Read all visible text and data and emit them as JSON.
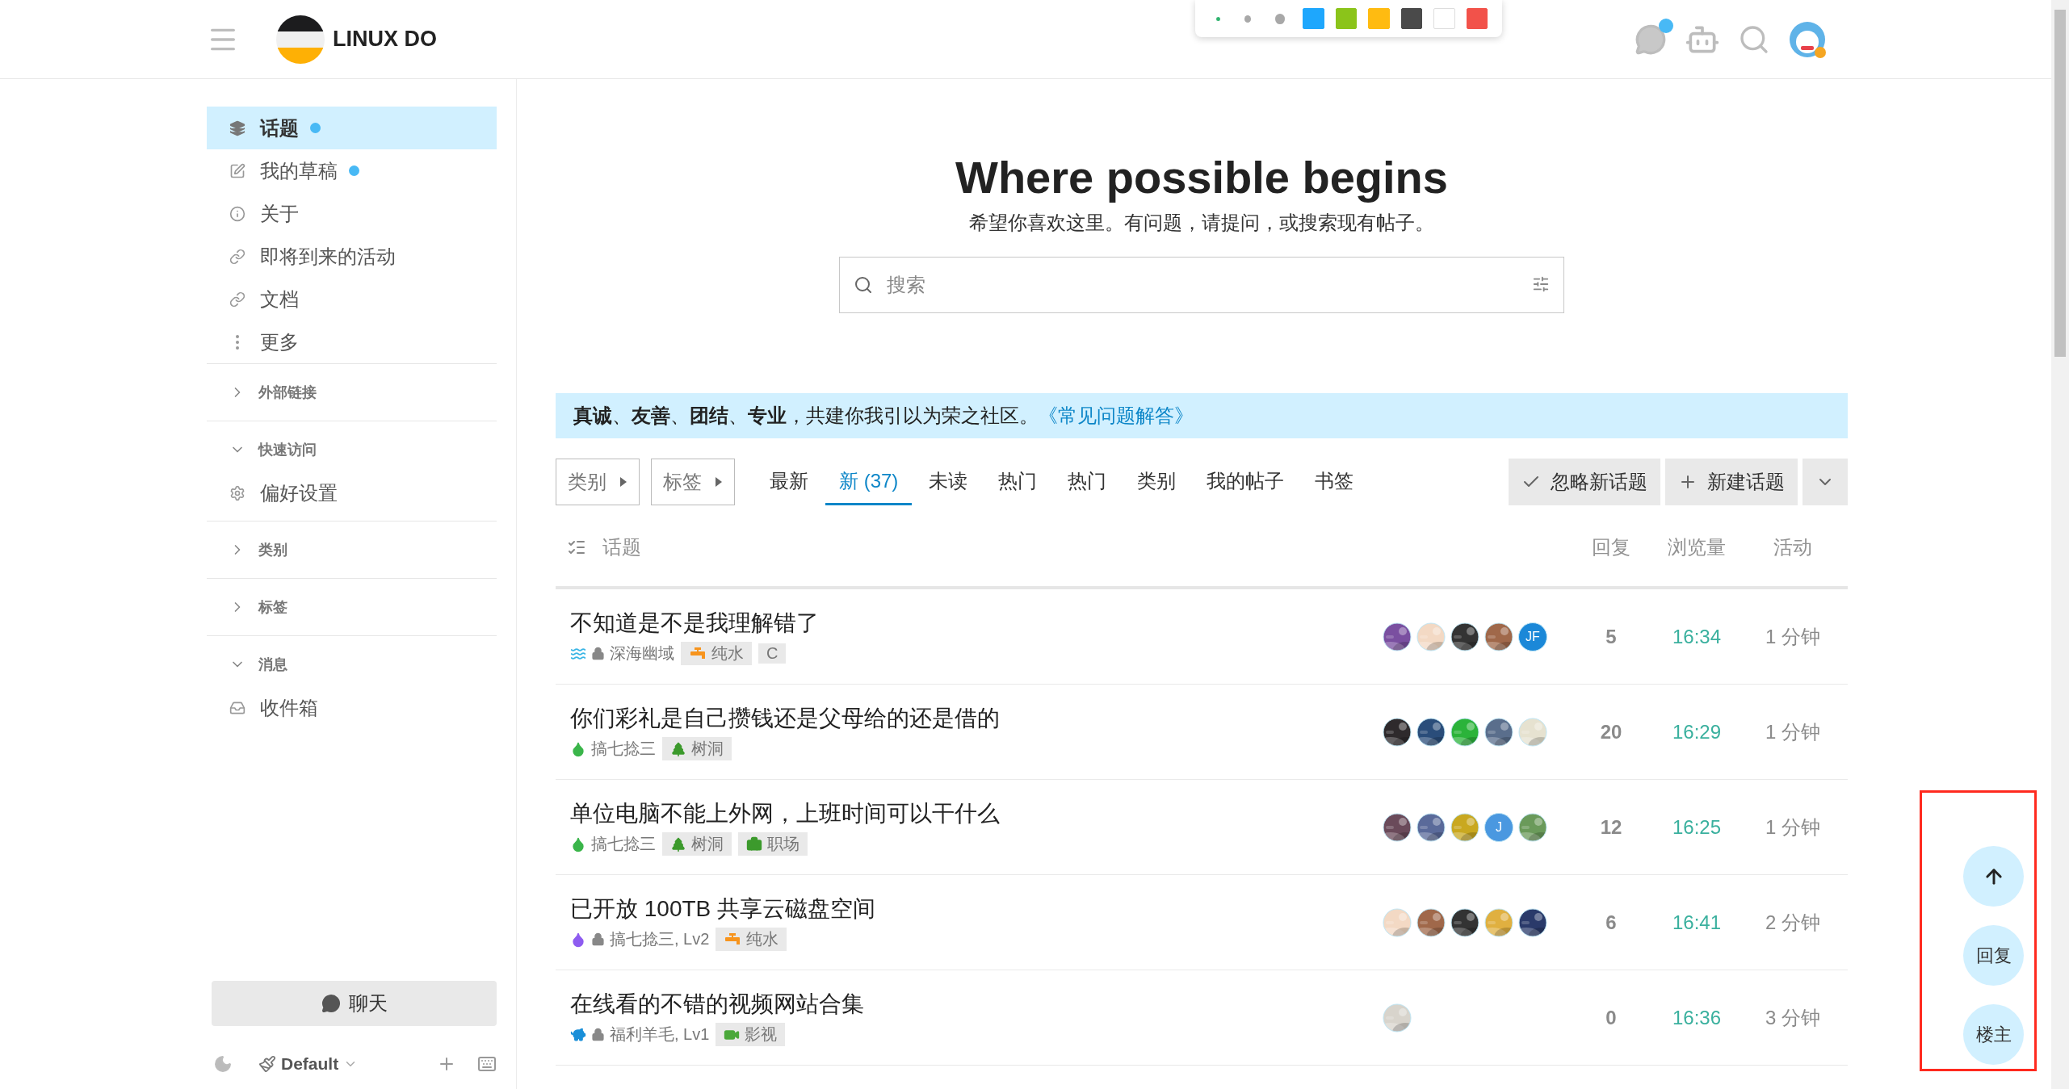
{
  "header": {
    "site_name": "LINUX DO",
    "chat_unread": true,
    "palette": [
      {
        "kind": "small",
        "color": "#2fb36e"
      },
      {
        "kind": "medium",
        "color": "#a8a8a8"
      },
      {
        "kind": "large",
        "color": "#a8a8a8"
      },
      {
        "kind": "swatch",
        "color": "#1ea7fd"
      },
      {
        "kind": "swatch",
        "color": "#8bc41a"
      },
      {
        "kind": "swatch",
        "color": "#ffbb11"
      },
      {
        "kind": "swatch",
        "color": "#4a4a4a"
      },
      {
        "kind": "swatch",
        "color": "#ffffff"
      },
      {
        "kind": "swatch",
        "color": "#f2524a"
      }
    ]
  },
  "sidebar": {
    "items": [
      {
        "label": "话题",
        "selected": true,
        "unread": true
      },
      {
        "label": "我的草稿",
        "selected": false,
        "unread": true
      },
      {
        "label": "关于",
        "selected": false,
        "unread": false
      },
      {
        "label": "即将到来的活动",
        "selected": false,
        "unread": false
      },
      {
        "label": "文档",
        "selected": false,
        "unread": false
      },
      {
        "label": "更多",
        "selected": false,
        "unread": false
      }
    ],
    "sections": [
      {
        "title": "外部链接",
        "expanded": false
      },
      {
        "title": "快速访问",
        "expanded": true,
        "items": [
          {
            "label": "偏好设置"
          }
        ]
      },
      {
        "title": "类别",
        "expanded": false
      },
      {
        "title": "标签",
        "expanded": false
      },
      {
        "title": "消息",
        "expanded": true,
        "items": [
          {
            "label": "收件箱"
          }
        ]
      }
    ],
    "chat_button": "聊天",
    "theme": "Default"
  },
  "hero": {
    "title": "Where possible begins",
    "subtitle": "希望你喜欢这里。有问题，请提问，或搜索现有帖子。",
    "search": {
      "placeholder": "搜索"
    }
  },
  "banner": {
    "text": "**真诚**、**友善**、**团结**、**专业**，共建你我引以为荣之社区。",
    "link": "《常见问题解答》"
  },
  "nav": {
    "filters": [
      {
        "label": "类别"
      },
      {
        "label": "标签"
      }
    ],
    "tabs": [
      {
        "label": "最新",
        "selected": false
      },
      {
        "label": "新 (37)",
        "selected": true
      },
      {
        "label": "未读",
        "selected": false
      },
      {
        "label": "热门",
        "selected": false
      },
      {
        "label": "热门",
        "selected": false
      },
      {
        "label": "类别",
        "selected": false
      },
      {
        "label": "我的帖子",
        "selected": false
      },
      {
        "label": "书签",
        "selected": false
      }
    ],
    "actions": [
      {
        "label": "忽略新话题"
      },
      {
        "label": "新建话题"
      }
    ]
  },
  "table": {
    "columns": [
      "话题",
      "回复",
      "浏览量",
      "活动"
    ],
    "rows": [
      {
        "title": "不知道是不是我理解错了",
        "category": {
          "kind": "waves",
          "color": "#3ab5e5",
          "locked": true,
          "name": "深海幽域"
        },
        "tags": [
          {
            "kind": "faucet",
            "color": "#f7941d",
            "label": "纯水"
          },
          {
            "kind": "plain",
            "label": "C"
          }
        ],
        "posters": [
          {
            "kind": "picture",
            "color": "#7a4fa0"
          },
          {
            "kind": "picture",
            "color": "#f3d9c4"
          },
          {
            "kind": "picture",
            "color": "#333333"
          },
          {
            "kind": "picture",
            "color": "#a0684a"
          },
          {
            "kind": "letter",
            "text": "JF",
            "color": "#1b88d8"
          }
        ],
        "replies": "5",
        "views": "16:34",
        "activity": "1 分钟"
      },
      {
        "title": "你们彩礼是自己攒钱还是父母给的还是借的",
        "category": {
          "kind": "droplet",
          "color": "#3ab54a",
          "locked": false,
          "name": "搞七捻三"
        },
        "tags": [
          {
            "kind": "tree",
            "color": "#3c9a2c",
            "label": "树洞"
          }
        ],
        "posters": [
          {
            "kind": "picture",
            "color": "#2e2a2c"
          },
          {
            "kind": "picture",
            "color": "#2a4d7a"
          },
          {
            "kind": "picture",
            "color": "#2bb33a"
          },
          {
            "kind": "picture",
            "color": "#5a6e8c"
          },
          {
            "kind": "picture",
            "color": "#e6e2d0"
          }
        ],
        "replies": "20",
        "views": "16:29",
        "activity": "1 分钟"
      },
      {
        "title": "单位电脑不能上外网，上班时间可以干什么",
        "category": {
          "kind": "droplet",
          "color": "#3ab54a",
          "locked": false,
          "name": "搞七捻三"
        },
        "tags": [
          {
            "kind": "tree",
            "color": "#3c9a2c",
            "label": "树洞"
          },
          {
            "kind": "briefcase",
            "color": "#3c9a2c",
            "label": "职场"
          }
        ],
        "posters": [
          {
            "kind": "picture",
            "color": "#6a4a5a"
          },
          {
            "kind": "picture",
            "color": "#5a6a9a"
          },
          {
            "kind": "picture",
            "color": "#c9a820"
          },
          {
            "kind": "letter",
            "text": "J",
            "color": "#4a98e0"
          },
          {
            "kind": "picture",
            "color": "#6a9a5a"
          }
        ],
        "replies": "12",
        "views": "16:25",
        "activity": "1 分钟"
      },
      {
        "title": "已开放 100TB 共享云磁盘空间",
        "category": {
          "kind": "droplet",
          "color": "#8e5cf0",
          "locked": true,
          "name": "搞七捻三, Lv2"
        },
        "tags": [
          {
            "kind": "faucet",
            "color": "#f7941d",
            "label": "纯水"
          }
        ],
        "posters": [
          {
            "kind": "picture",
            "color": "#f3d9c4"
          },
          {
            "kind": "picture",
            "color": "#a0684a"
          },
          {
            "kind": "picture",
            "color": "#333333"
          },
          {
            "kind": "picture",
            "color": "#e0b040"
          },
          {
            "kind": "picture",
            "color": "#2a3a6a"
          }
        ],
        "replies": "6",
        "views": "16:41",
        "activity": "2 分钟"
      },
      {
        "title": "在线看的不错的视频网站合集",
        "category": {
          "kind": "piggy",
          "color": "#1a8fd8",
          "locked": true,
          "name": "福利羊毛, Lv1"
        },
        "tags": [
          {
            "kind": "video",
            "color": "#4aa83a",
            "label": "影视"
          }
        ],
        "posters": [
          {
            "kind": "picture",
            "color": "#d8d4cc"
          }
        ],
        "replies": "0",
        "views": "16:36",
        "activity": "3 分钟"
      }
    ]
  },
  "floating": {
    "highlighted": true,
    "buttons": [
      {
        "kind": "icon"
      },
      {
        "kind": "text",
        "label": "回复"
      },
      {
        "kind": "text",
        "label": "楼主"
      }
    ]
  }
}
